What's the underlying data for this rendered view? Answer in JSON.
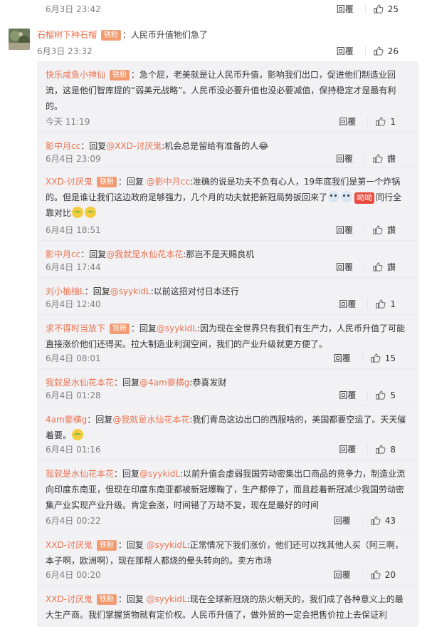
{
  "top_comment": {
    "time": "6月3日 23:42",
    "reply_label": "回覆",
    "like_count": "25"
  },
  "main_comment": {
    "user": "石榴树下种石榴",
    "badge": "铁粉",
    "text": "：人民币升值牠们急了",
    "time": "6月3日 23:32",
    "reply_label": "回覆",
    "like_count": "26"
  },
  "replies": [
    {
      "user": "快乐咸鱼小神仙",
      "badge": "铁粉",
      "reply_to": "",
      "text": "：急个屁，老美就是让人民币升值，影响我们出口，促进他们制造业回流，这是他们智库提的“弱美元战略”。人民币没必要升值也没必要减值，保持稳定才是最有利的。",
      "time": "今天 11:19",
      "reply_label": "回覆",
      "like_count": "1"
    },
    {
      "user": "影中月cc",
      "badge": "",
      "reply_to": "@XXD-讨厌鬼",
      "prefix": "：回复",
      "text": ":机会总是留给有准备的人😂",
      "time": "6月4日 23:09",
      "reply_label": "回覆",
      "like_count": "讚"
    },
    {
      "user": "XXD-讨厌鬼",
      "badge": "铁粉",
      "reply_to": "@影中月cc",
      "prefix": "：回复 ",
      "text": ":准确的说是功夫不负有心人，19年底我们是第一个炸锅的。但是谁让我们这边政府足够强力，几个月的功夫就把新冠局势扳回来了",
      "text_after": "同行全靠对比",
      "sticker": "呦呦",
      "time": "6月4日 18:51",
      "reply_label": "回覆",
      "like_count": "讚"
    },
    {
      "user": "影中月cc",
      "badge": "",
      "reply_to": "@我就是水仙花本花",
      "prefix": "：回复",
      "text": ":那岂不是天赐良机",
      "time": "6月4日 17:44",
      "reply_label": "回覆",
      "like_count": "讚"
    },
    {
      "user": "刘小柚柚L",
      "badge": "",
      "reply_to": "@syykidL",
      "prefix": "：回复",
      "text": ":以前这招对付日本还行",
      "time": "6月4日 12:40",
      "reply_label": "回覆",
      "like_count": "1"
    },
    {
      "user": "求不得时当放下",
      "badge": "铁粉",
      "reply_to": "@syykidL",
      "prefix": "：回复",
      "text": ":因为现在全世界只有我们有生产力，人民币升值了可能直接涨价他们还得买。拉大制造业利润空间，我们的产业升级就更方便了。",
      "time": "6月4日 08:01",
      "reply_label": "回覆",
      "like_count": "15"
    },
    {
      "user": "我就是水仙花本花",
      "badge": "",
      "reply_to": "@4am豪横g",
      "prefix": "：回复",
      "text": ":恭喜发财",
      "time": "6月4日 01:28",
      "reply_label": "回覆",
      "like_count": "5"
    },
    {
      "user": "4am豪横g",
      "badge": "",
      "reply_to": "@我就是水仙花本花",
      "prefix": "：回复",
      "text": ":我们青岛这边出口的西服啥的，美国都要空运了。天天催着要。",
      "time": "6月4日 01:16",
      "reply_label": "回覆",
      "like_count": "8"
    },
    {
      "user": "我就是水仙花本花",
      "badge": "",
      "reply_to": "@syykidL",
      "prefix": "：回复",
      "text": ":以前升值会虚弱我国劳动密集出口商品的竞争力，制造业流向印度东南亚，但现在印度东南亚都被新冠爆鞠了，生产都停了，而且趁着新冠减少我国劳动密集产业实现产业升级。肯定会涨，时间错了万劫不复，现在是最好的时间",
      "time": "6月4日 00:22",
      "reply_label": "回覆",
      "like_count": "43"
    },
    {
      "user": "XXD-讨厌鬼",
      "badge": "铁粉",
      "reply_to": "@syykidL",
      "prefix": "：回复 ",
      "text": ":正常情况下我们涨价，他们还可以找其他人买（阿三啊，本子啊，欧洲啊），现在那帮人都烧的晕头转向的。卖方市场",
      "time": "6月4日 00:20",
      "reply_label": "回覆",
      "like_count": "20"
    },
    {
      "user": "XXD-讨厌鬼",
      "badge": "铁粉",
      "reply_to": "@syykidL",
      "prefix": "：回复 ",
      "text": ":现在全球新冠烧的热火朝天的，我们成了各种意义上的最大生产商。我们掌握货物就有定价权。人民币升值了，做外贸的一定会把售价拉上去保证利",
      "time": "",
      "reply_label": "",
      "like_count": ""
    }
  ],
  "colors": {
    "user_name": "#eb7350",
    "badge_bg": "#f39a6f",
    "reply_box_bg": "#f2f2f5",
    "time": "#808080"
  },
  "icons": {
    "like": "thumbs-up-icon",
    "avatar": "avatar-image"
  }
}
